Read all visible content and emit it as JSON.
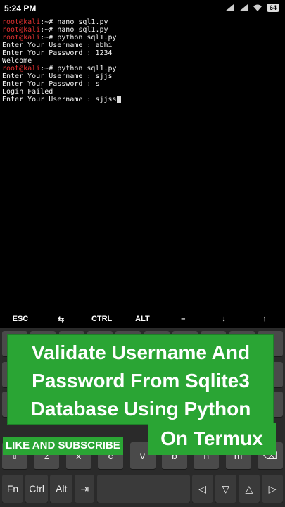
{
  "status_bar": {
    "time": "5:24 PM",
    "battery": "64"
  },
  "terminal": {
    "lines": [
      {
        "user": "root@kali",
        "rest": ":~# nano sql1.py"
      },
      {
        "user": "root@kali",
        "rest": ":~# nano sql1.py"
      },
      {
        "user": "root@kali",
        "rest": ":~# python sql1.py"
      },
      {
        "user": "",
        "rest": "Enter Your Username : abhi"
      },
      {
        "user": "",
        "rest": "Enter Your Password : 1234"
      },
      {
        "user": "",
        "rest": "Welcome"
      },
      {
        "user": "root@kali",
        "rest": ":~# python sql1.py"
      },
      {
        "user": "",
        "rest": "Enter Your Username : sjjs"
      },
      {
        "user": "",
        "rest": "Enter Your Password : s"
      },
      {
        "user": "",
        "rest": "Login Failed"
      },
      {
        "user": "",
        "rest": "Enter Your Username : sjjss"
      }
    ]
  },
  "extra_keys": [
    "ESC",
    "⇆",
    "CTRL",
    "ALT",
    "–",
    "↓",
    "↑"
  ],
  "keyboard": {
    "row_letters": [
      "z",
      "x",
      "c",
      "v",
      "b",
      "n",
      "m"
    ],
    "bottom_row": [
      "Fn",
      "Ctrl",
      "Alt",
      "⇥",
      "",
      "◁",
      "▽",
      "△",
      "▷"
    ]
  },
  "banner": {
    "lines": [
      "Validate Username And",
      "Password From Sqlite3",
      "Database Using Python"
    ],
    "on_termux": "On Termux",
    "subscribe": "LIKE AND SUBSCRIBE"
  }
}
